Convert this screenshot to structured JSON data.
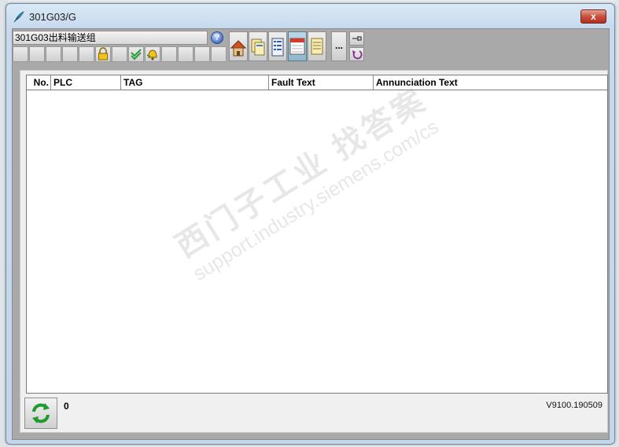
{
  "window": {
    "title": "301G03/G",
    "close_label": "x"
  },
  "toolbar": {
    "group_name": "301G03出料输送组",
    "help_label": "?",
    "more_label": "..."
  },
  "table": {
    "columns": [
      "No.",
      "PLC",
      "TAG",
      "Fault Text",
      "Annunciation Text"
    ],
    "rows": []
  },
  "footer": {
    "count": "0",
    "version": "V9100.190509"
  },
  "watermark": {
    "line1": "西门子工业 找答案",
    "line2": "support.industry.siemens.com/cs"
  },
  "colors": {
    "close_button": "#c9503c",
    "window_frame": "#c7daee",
    "client_bg": "#a9a9a9"
  },
  "icons": [
    "feather-icon",
    "close-icon",
    "help-icon",
    "lock-icon",
    "check-icon",
    "bell-icon",
    "home-icon",
    "documents-icon",
    "list-icon",
    "calendar-icon",
    "notes-icon",
    "pin-icon",
    "undo-icon",
    "refresh-icon"
  ]
}
